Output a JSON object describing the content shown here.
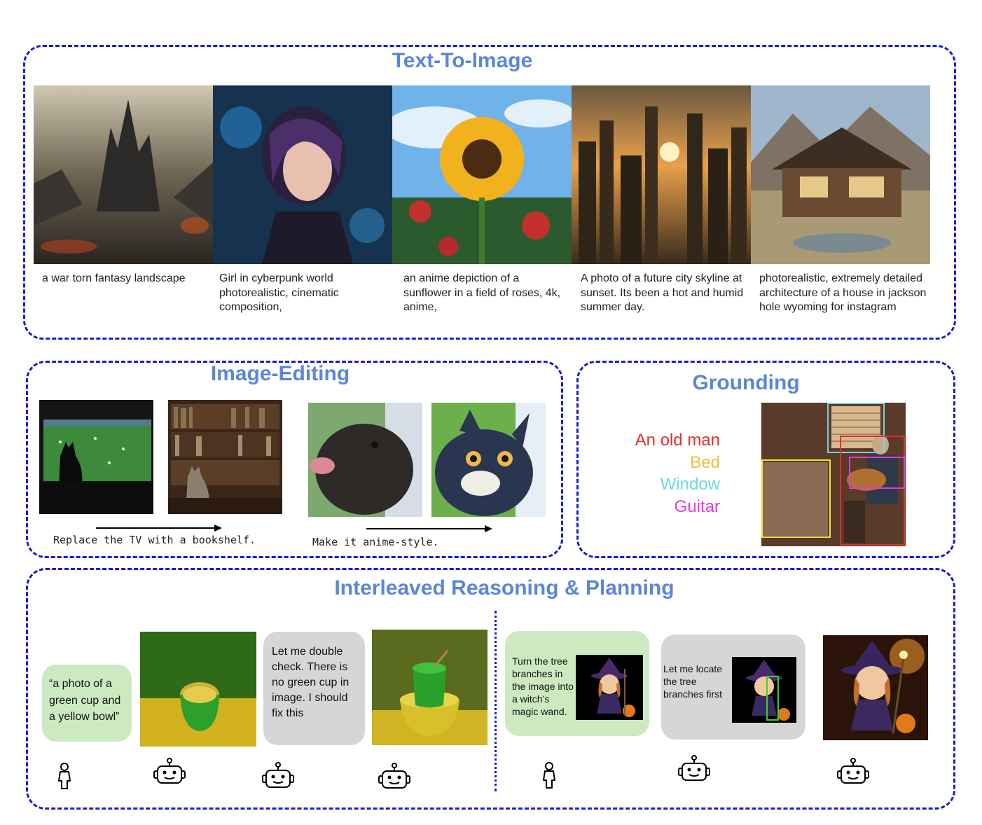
{
  "text_to_image": {
    "title": "Text-To-Image",
    "captions": [
      "a war torn fantasy landscape",
      "Girl in cyberpunk world photorealistic, cinematic composition,",
      "an anime depiction of a sunflower in a field of roses, 4k, anime,",
      "A photo of a future city skyline at sunset. Its been a hot and humid summer day.",
      "photorealistic, extremely detailed architecture of a house in jackson hole wyoming for instagram"
    ]
  },
  "image_editing": {
    "title": "Image-Editing",
    "instruction_1": "Replace the TV with a bookshelf.",
    "instruction_2": "Make it anime-style."
  },
  "grounding": {
    "title": "Grounding",
    "labels": [
      {
        "text": "An old man",
        "color": "#e0302a"
      },
      {
        "text": "Bed",
        "color": "#e6c23a"
      },
      {
        "text": "Window",
        "color": "#6fd6e0"
      },
      {
        "text": "Guitar",
        "color": "#e03ae0"
      }
    ]
  },
  "interleaved": {
    "title": "Interleaved Reasoning & Planning",
    "user_prompt_1": "“a photo of a green cup and a yellow bowl”",
    "bot_reply_1": "Let me double check. There is no green cup in image. I should fix this",
    "user_prompt_2": "Turn the tree branches in the image into a witch’s magic wand.",
    "bot_reply_2": "Let me locate the tree branches first"
  },
  "icons": [
    "person-icon",
    "robot-icon",
    "arrow-right-icon"
  ]
}
